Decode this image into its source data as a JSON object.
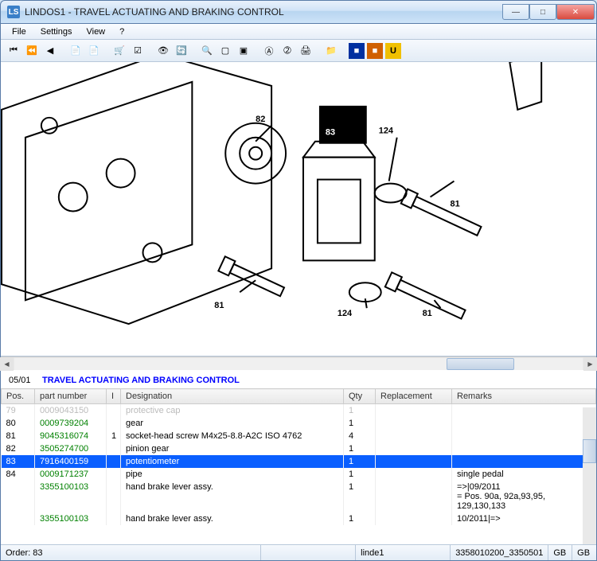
{
  "window": {
    "title": "LINDOS1 - TRAVEL ACTUATING AND BRAKING CONTROL",
    "icon_letter": "LS"
  },
  "menu": {
    "file": "File",
    "settings": "Settings",
    "view": "View",
    "help": "?"
  },
  "toolbar_icons": [
    "nav-first",
    "nav-prev",
    "nav-back",
    "export-1",
    "export-2",
    "cart",
    "checkbox",
    "eye-off",
    "refresh",
    "zoom-in",
    "doc",
    "doc2",
    "target",
    "arrow-a",
    "print",
    "folder",
    "square-blue",
    "square-orange",
    "u-yellow"
  ],
  "diagram": {
    "labels": {
      "a": "82",
      "b": "83",
      "c": "124",
      "d": "81",
      "e": "81",
      "f": "81",
      "g": "124"
    },
    "selected": "83"
  },
  "section": {
    "code": "05/01",
    "name": "TRAVEL ACTUATING AND BRAKING CONTROL"
  },
  "columns": {
    "pos": "Pos.",
    "pn": "part number",
    "i": "I",
    "desig": "Designation",
    "qty": "Qty",
    "repl": "Replacement",
    "rem": "Remarks"
  },
  "rows": [
    {
      "pos": "79",
      "pn": "0009043150",
      "i": "",
      "desig": "protective cap",
      "qty": "1",
      "repl": "",
      "rem": "",
      "faded": true
    },
    {
      "pos": "80",
      "pn": "0009739204",
      "i": "",
      "desig": "gear",
      "qty": "1",
      "repl": "",
      "rem": ""
    },
    {
      "pos": "81",
      "pn": "9045316074",
      "i": "1",
      "desig": "socket-head screw M4x25-8.8-A2C  ISO 4762",
      "qty": "4",
      "repl": "",
      "rem": ""
    },
    {
      "pos": "82",
      "pn": "3505274700",
      "i": "",
      "desig": "pinion gear",
      "qty": "1",
      "repl": "",
      "rem": ""
    },
    {
      "pos": "83",
      "pn": "7916400159",
      "i": "",
      "desig": "potentiometer",
      "qty": "1",
      "repl": "",
      "rem": "",
      "sel": true,
      "pnred": true
    },
    {
      "pos": "84",
      "pn": "0009171237",
      "i": "",
      "desig": "pipe",
      "qty": "1",
      "repl": "",
      "rem": "single pedal"
    },
    {
      "pos": "",
      "pn": "3355100103",
      "i": "",
      "desig": "hand brake lever assy.",
      "qty": "1",
      "repl": "",
      "rem": "=>|09/2011\n= Pos. 90a, 92a,93,95, 129,130,133"
    },
    {
      "pos": "",
      "pn": "3355100103",
      "i": "",
      "desig": "hand brake lever assy.",
      "qty": "1",
      "repl": "",
      "rem": "10/2011|=>"
    }
  ],
  "status": {
    "order": "Order: 83",
    "mid": "linde1",
    "right": "3358010200_3350501",
    "gb1": "GB",
    "gb2": "GB"
  }
}
